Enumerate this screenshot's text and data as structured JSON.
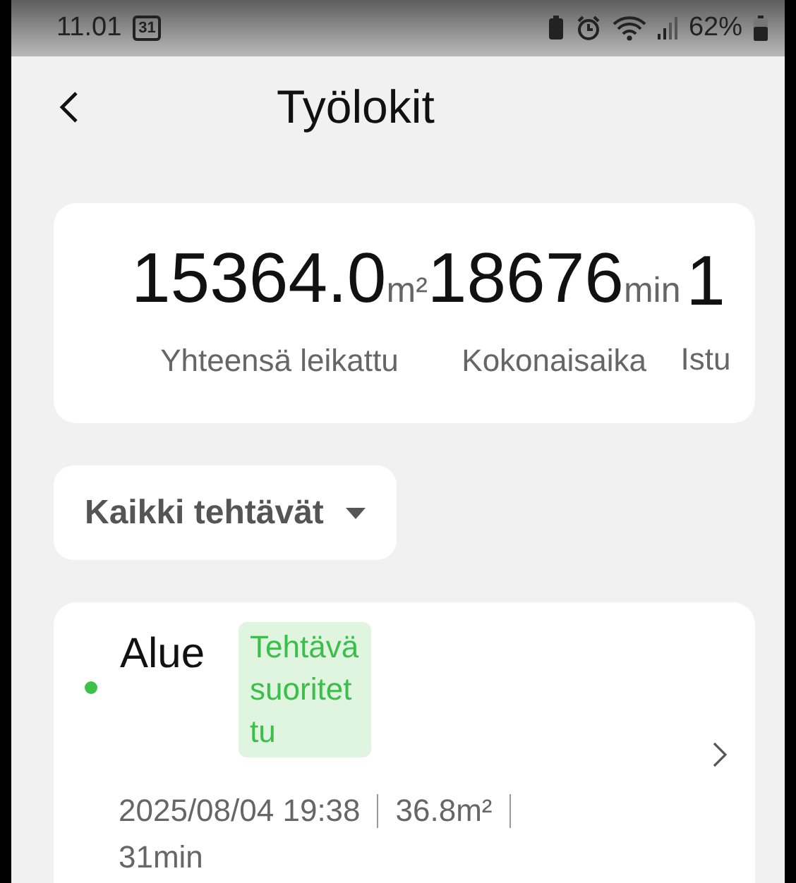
{
  "status_bar": {
    "time": "11.01",
    "calendar_day": "31",
    "battery": "62%"
  },
  "header": {
    "title": "Työlokit"
  },
  "stats": [
    {
      "value": "15364.0",
      "unit": "m²",
      "label": "Yhteensä leikattu"
    },
    {
      "value": "18676",
      "unit": "min",
      "label": "Kokonaisaika"
    },
    {
      "value": "1",
      "label": "Istu"
    }
  ],
  "filter": {
    "label": "Kaikki tehtävät"
  },
  "tasks": [
    {
      "name": "Alue",
      "color": "#3cc24a",
      "status": "Tehtävä suoritettu",
      "completed": true,
      "date": "2025/08/04 19:38",
      "area": "36.8m²",
      "duration": "31min"
    }
  ]
}
